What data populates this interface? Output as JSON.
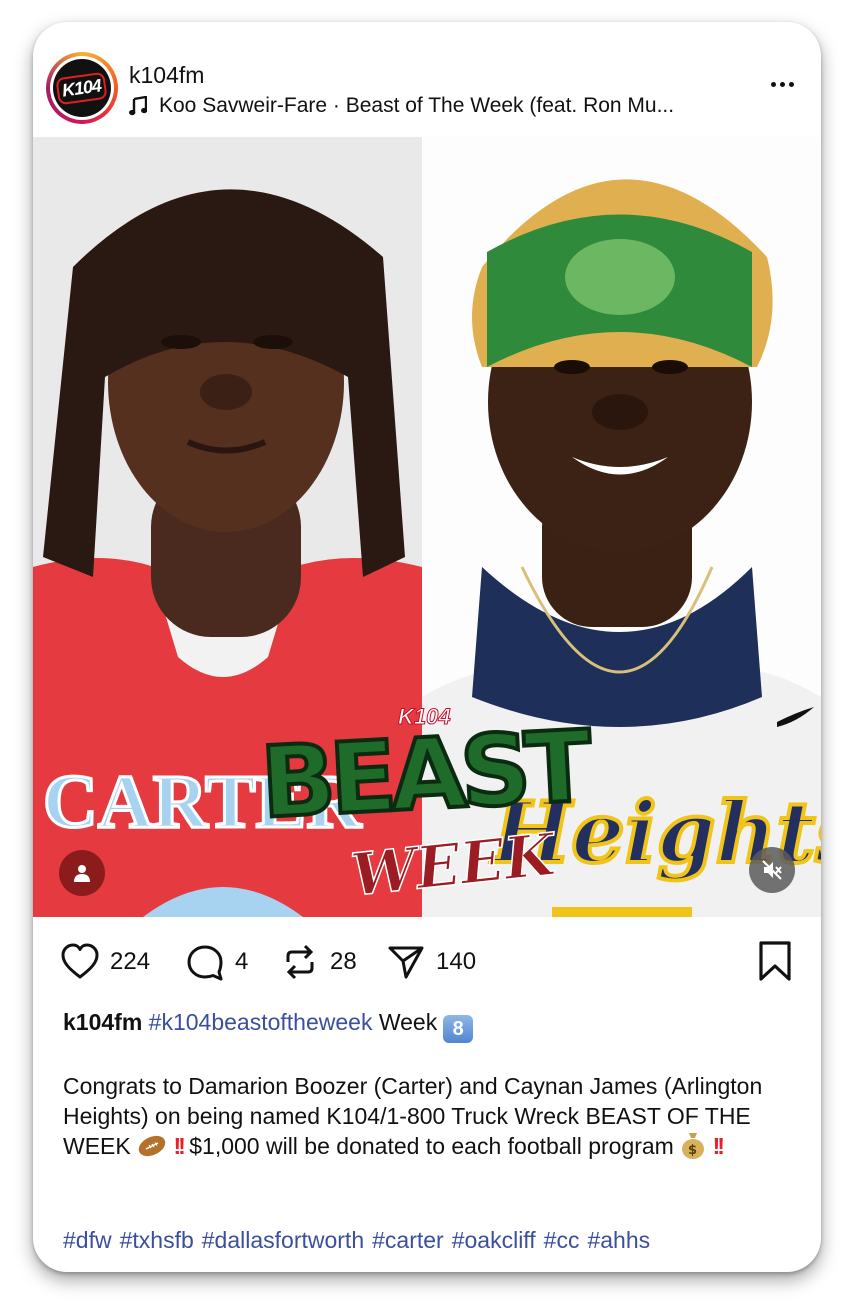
{
  "header": {
    "avatar_logo": "K104",
    "username": "k104fm",
    "audio": "Koo Savweir-Fare · Beast of The Week (feat. Ron Mu..."
  },
  "media": {
    "left_jersey_text": "CARTER",
    "right_jersey_text": "Heights",
    "overlay_brand": "K104",
    "overlay_title": "BEAST",
    "overlay_subtitle": "WEEK"
  },
  "actions": {
    "likes": "224",
    "comments": "4",
    "reposts": "28",
    "shares": "140"
  },
  "caption": {
    "username": "k104fm",
    "hashtag": "#k104beastoftheweek",
    "week_text": "Week",
    "week_badge": "8",
    "body_1": "Congrats to Damarion Boozer (Carter) and Caynan James (Arlington Heights) on being named K104/1-800 Truck Wreck BEAST OF THE WEEK",
    "body_2": "$1,000 will be donated to each football program",
    "exclaim": "!!"
  },
  "tags": [
    "#dfw",
    "#txhsfb",
    "#dallasfortworth",
    "#carter",
    "#oakcliff",
    "#cc",
    "#ahhs"
  ],
  "colors": {
    "hashtag": "#3a4f9e",
    "user_tag_button": "#8c1c1c",
    "left_jersey": "#e53a3f",
    "right_jersey": "#f4f4f4"
  }
}
